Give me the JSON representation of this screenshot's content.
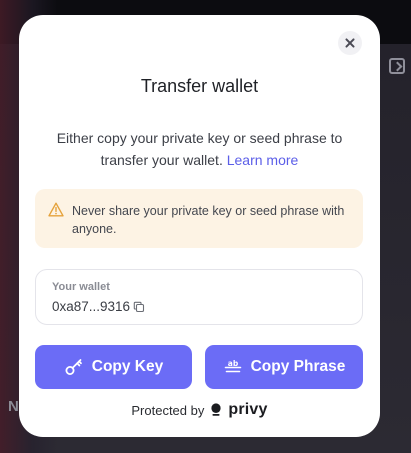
{
  "background": {
    "edge_glyph": "N"
  },
  "modal": {
    "title": "Transfer wallet",
    "description": "Either copy your private key or seed phrase to transfer your wallet.",
    "learn_more_link": "Learn more",
    "warning": {
      "icon": "warning-triangle-icon",
      "text": "Never share your private key or seed phrase with anyone."
    },
    "wallet": {
      "label": "Your wallet",
      "address": "0xa87...9316",
      "copy_icon": "copy-icon"
    },
    "buttons": {
      "copy_key": {
        "label": "Copy Key",
        "icon": "key-icon"
      },
      "copy_phrase": {
        "label": "Copy Phrase",
        "icon": "phrase-icon"
      }
    },
    "footer": {
      "protected_by": "Protected by",
      "brand": "privy"
    }
  },
  "colors": {
    "accent": "#6b6cf6",
    "link": "#5b5ee8",
    "warning_bg": "#fdf3e4",
    "warning_icon": "#e5a23b"
  }
}
